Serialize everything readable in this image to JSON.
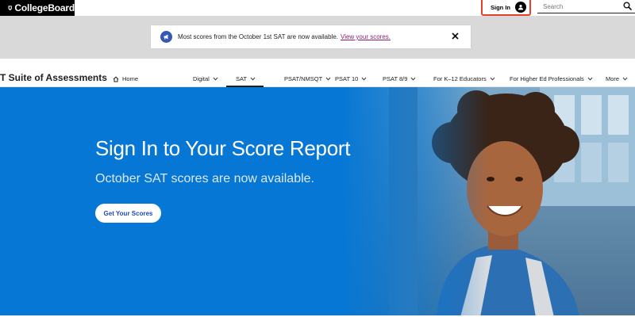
{
  "topbar": {
    "logo_text": "CollegeBoard",
    "signin_label": "Sign In",
    "search_placeholder": "Search"
  },
  "alert": {
    "message": "Most scores from the October 1st SAT are now available.",
    "link": "View your scores."
  },
  "nav": {
    "brand": "T Suite of Assessments",
    "home": "Home",
    "items": [
      {
        "label": "Digital"
      },
      {
        "label": "SAT"
      },
      {
        "label": "PSAT/NMSQT"
      },
      {
        "label": "PSAT 10"
      },
      {
        "label": "PSAT 8/9"
      },
      {
        "label": "For K–12 Educators"
      },
      {
        "label": "For Higher Ed Professionals"
      },
      {
        "label": "More"
      }
    ],
    "active_index": 1
  },
  "hero": {
    "title": "Sign In to Your Score Report",
    "subtitle": "October SAT scores are now available.",
    "cta": "Get Your Scores"
  },
  "colors": {
    "hero_blue": "#0677d4",
    "signin_highlight": "#e8402a",
    "alert_icon": "#3457b8",
    "link": "#8a1f6d",
    "cta_text": "#1f4bb3"
  }
}
